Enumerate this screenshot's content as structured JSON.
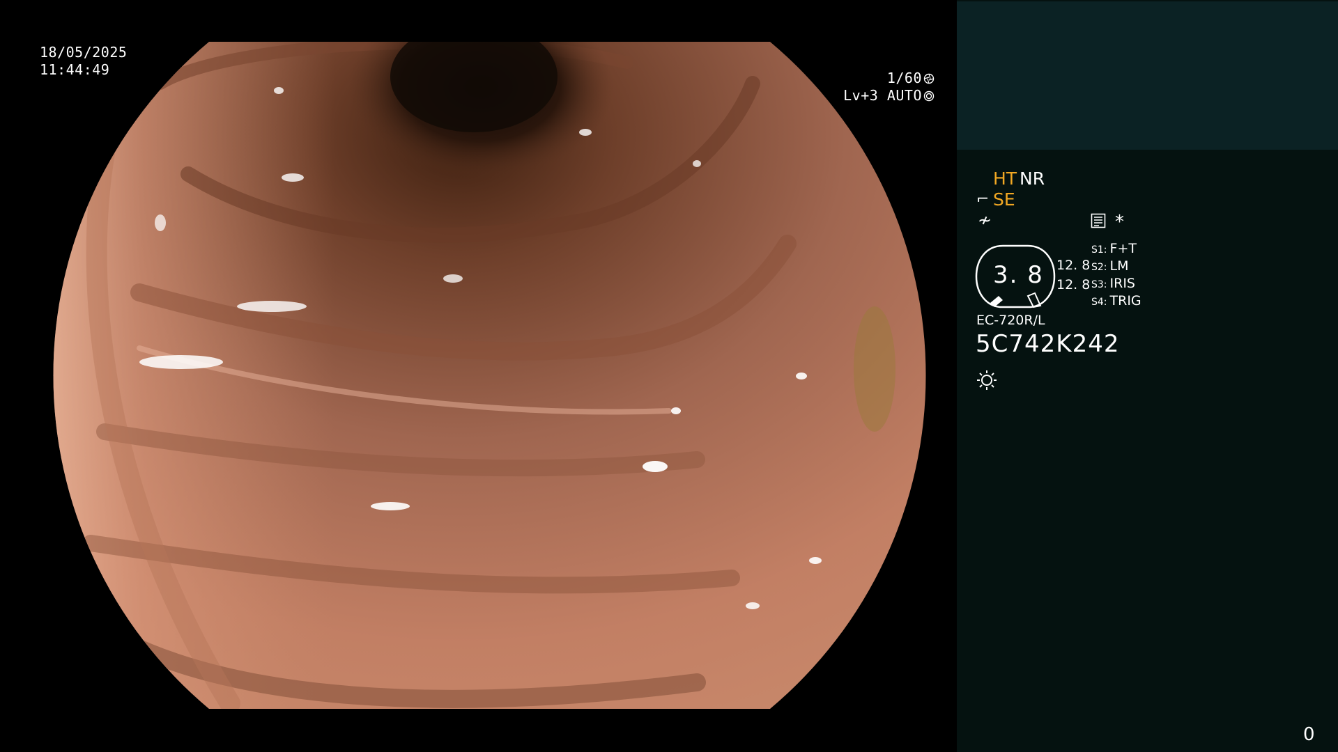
{
  "osd": {
    "date": "18/05/2025",
    "time": "11:44:49",
    "shutter": "1/60",
    "level": "Lv+3",
    "mode": "AUTO"
  },
  "panel": {
    "ht": "HT",
    "nr": "NR",
    "se": "SE",
    "gauge_value": "3. 8",
    "gauge_r1": "12. 8",
    "gauge_r2": "12. 8",
    "switches": [
      {
        "key": "S1:",
        "value": "F+T"
      },
      {
        "key": "S2:",
        "value": "LM"
      },
      {
        "key": "S3:",
        "value": "IRIS"
      },
      {
        "key": "S4:",
        "value": "TRIG"
      }
    ],
    "scope_model": "EC-720R/L",
    "scope_serial": "5C742K242",
    "counter": "0"
  },
  "icons": {
    "shutter": "shutter-icon",
    "auto": "iris-icon",
    "se": "scope-se-icon",
    "enhance": "enhance-icon",
    "record": "record-icon",
    "star": "star-icon",
    "light": "light-icon"
  },
  "colors": {
    "panel_bg": "#051210",
    "panel_header": "#0b2224",
    "accent_yellow": "#f2a823"
  }
}
